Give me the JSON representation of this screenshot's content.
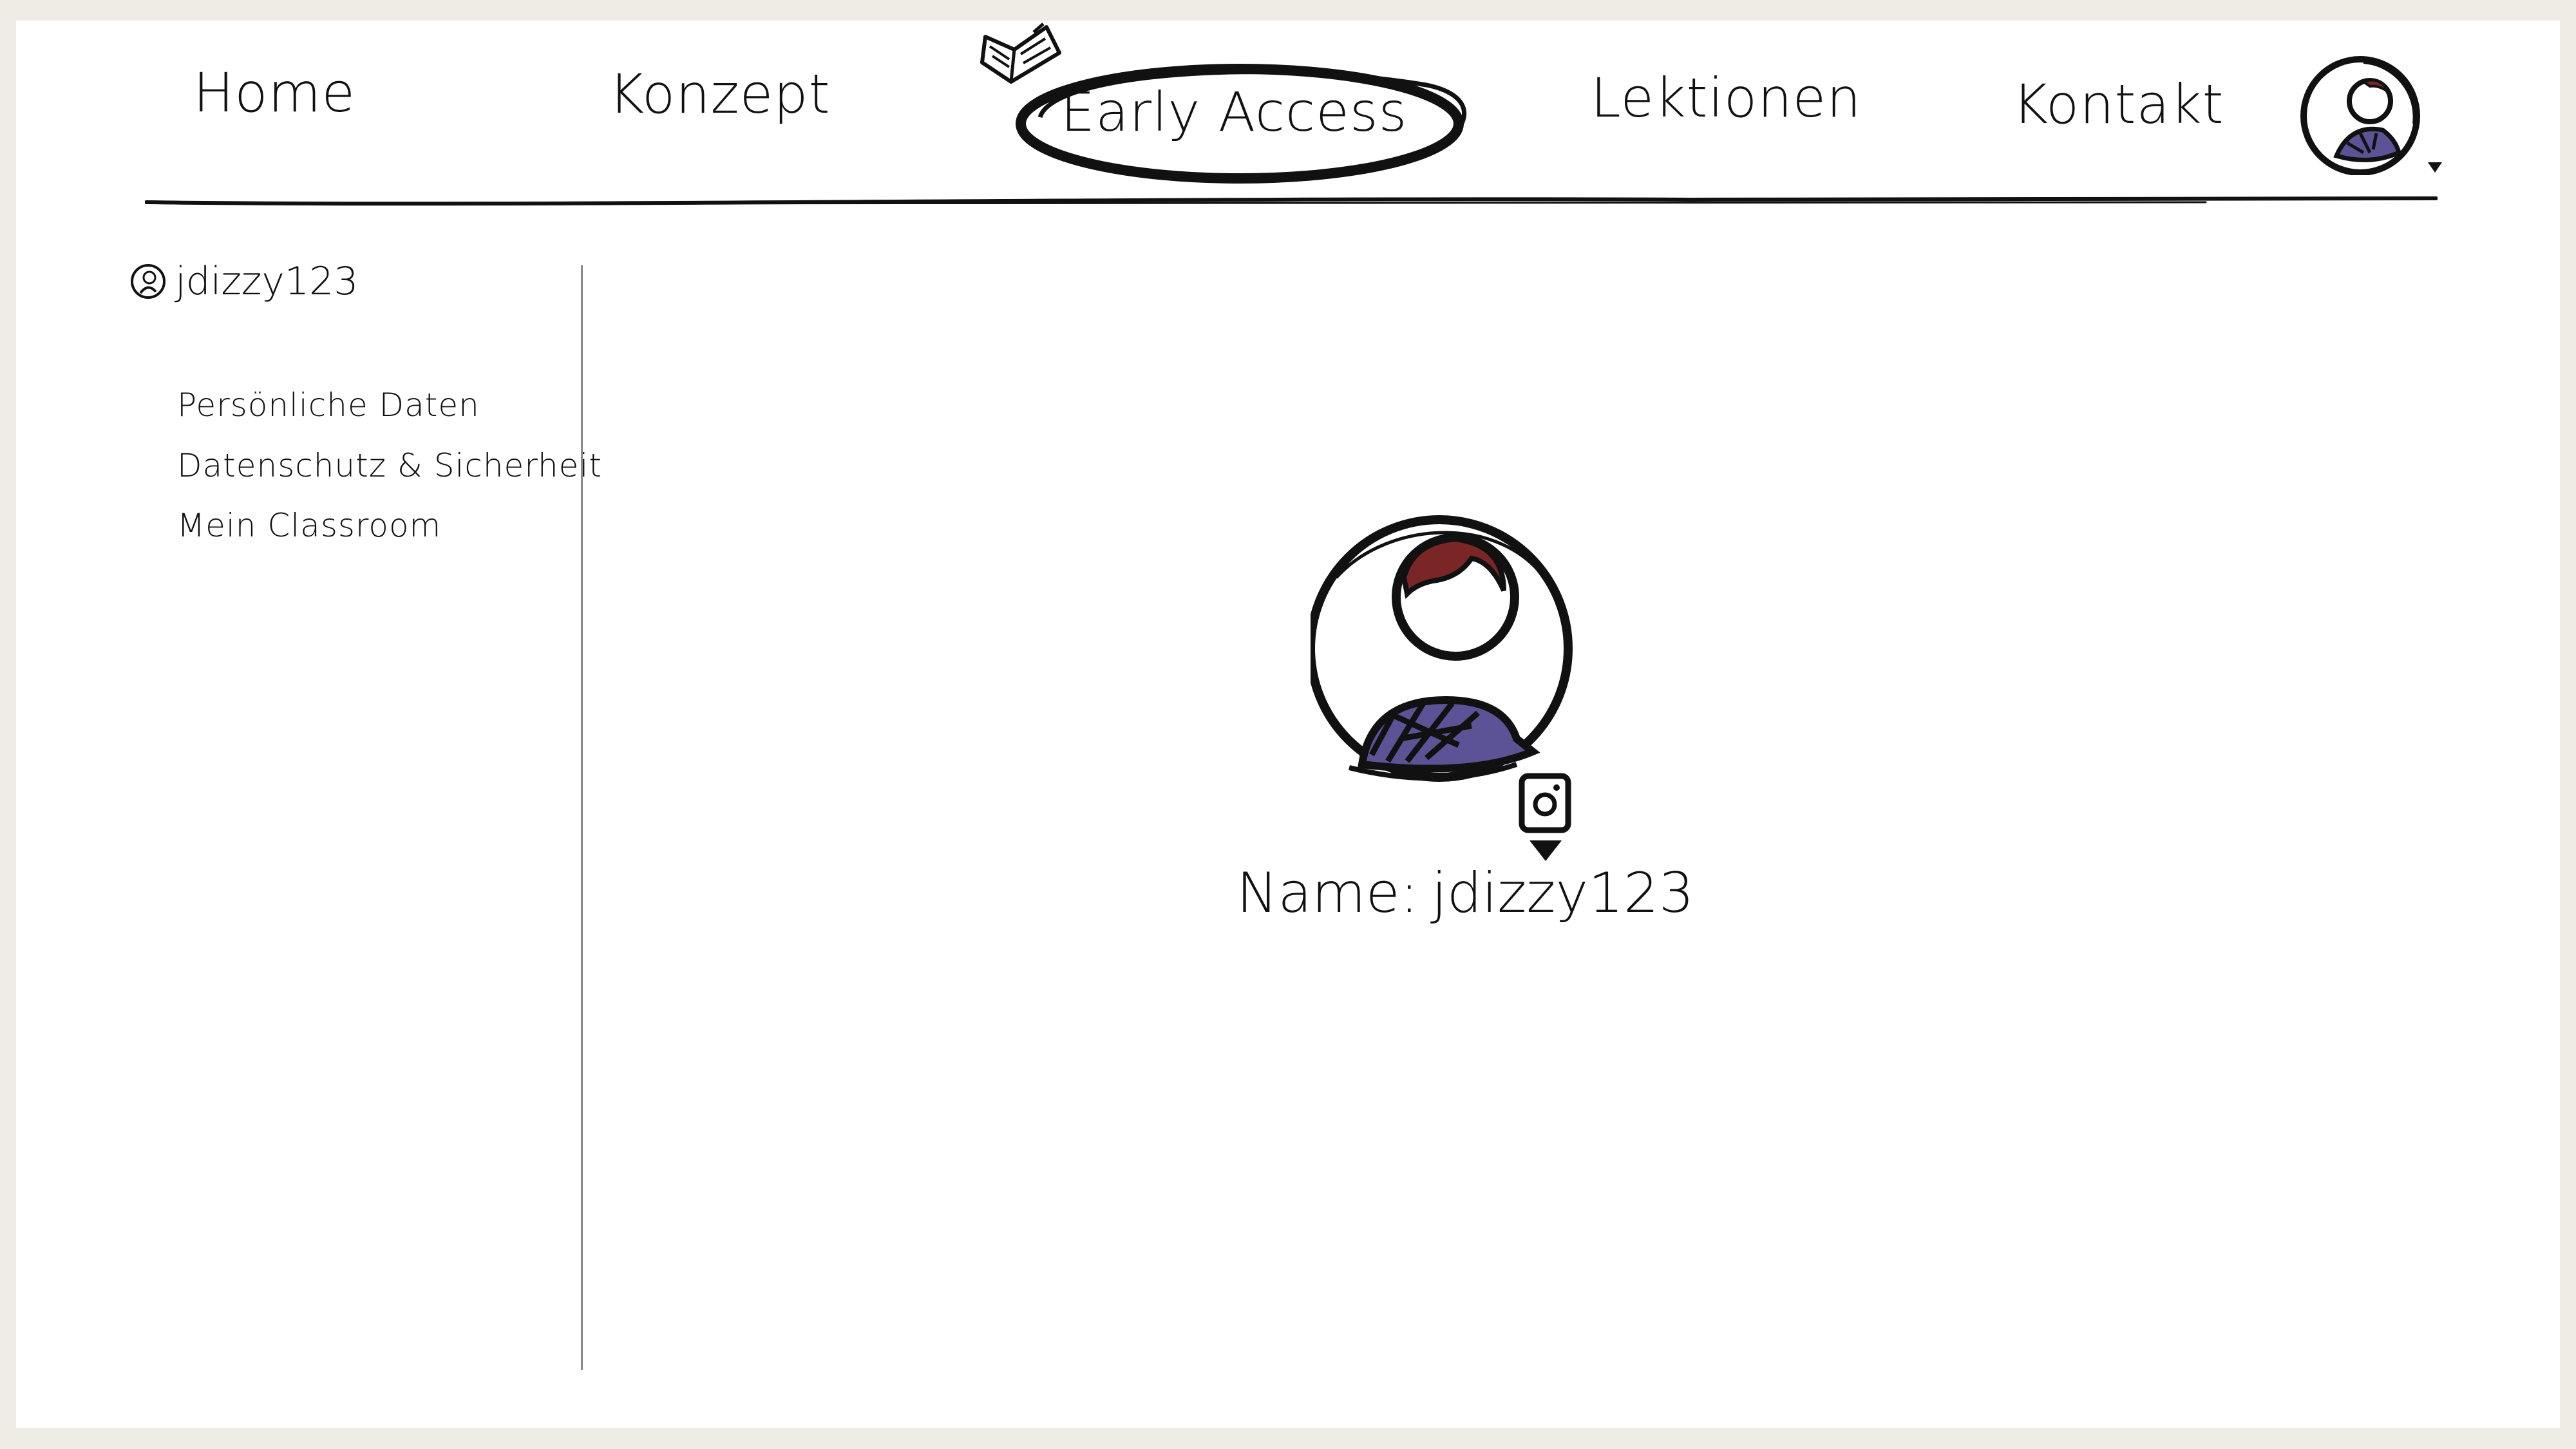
{
  "nav": {
    "items": [
      {
        "label": "Home"
      },
      {
        "label": "Konzept"
      },
      {
        "label": "Early Access"
      },
      {
        "label": "Lektionen"
      },
      {
        "label": "Kontakt"
      }
    ],
    "active_index": 2,
    "avatar_icon": "user-avatar-icon"
  },
  "sidebar": {
    "username": "jdizzy123",
    "links": [
      {
        "label": "Persönliche Daten"
      },
      {
        "label": "Datenschutz & Sicherheit"
      },
      {
        "label": "Mein Classroom"
      }
    ]
  },
  "profile": {
    "name_label": "Name:",
    "name_value": "jdizzy123",
    "camera_icon": "camera-icon"
  },
  "colors": {
    "page_bg": "#ffffff",
    "frame_bg": "#eeece5",
    "ink": "#111111",
    "hair": "#7a2626",
    "shirt": "#5b5396"
  }
}
